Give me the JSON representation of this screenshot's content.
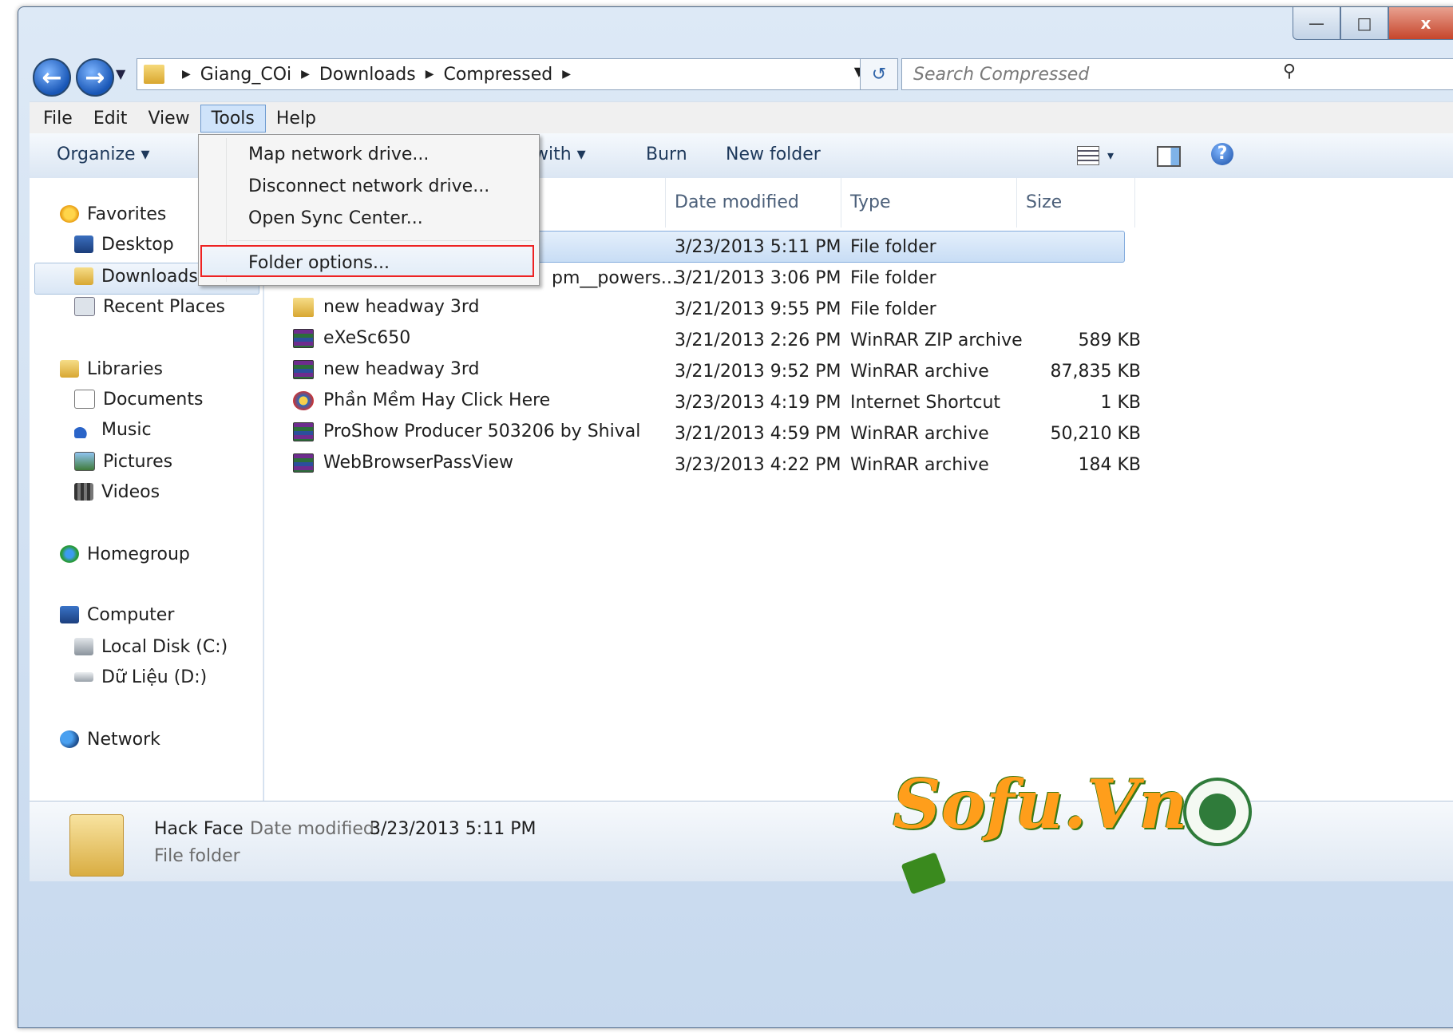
{
  "window": {
    "caption_buttons": {
      "minimize": "—",
      "maximize": "□",
      "close": "x"
    }
  },
  "address": {
    "breadcrumbs": [
      "Giang_COi",
      "Downloads",
      "Compressed"
    ],
    "search_placeholder": "Search Compressed"
  },
  "menubar": {
    "items": [
      "File",
      "Edit",
      "View",
      "Tools",
      "Help"
    ],
    "active": "Tools"
  },
  "toolbar": {
    "organize": "Organize ▾",
    "open_with": "with ▾",
    "burn": "Burn",
    "new_folder": "New folder",
    "view_toggle": "▾"
  },
  "tools_menu": {
    "items": [
      "Map network drive...",
      "Disconnect network drive...",
      "Open Sync Center...",
      "Folder options..."
    ],
    "highlighted": "Folder options..."
  },
  "nav": {
    "favorites": "Favorites",
    "desktop": "Desktop",
    "downloads": "Downloads",
    "recent": "Recent Places",
    "libraries": "Libraries",
    "documents": "Documents",
    "music": "Music",
    "pictures": "Pictures",
    "videos": "Videos",
    "homegroup": "Homegroup",
    "computer": "Computer",
    "local_disk": "Local Disk (C:)",
    "data_disk": "Dữ Liệu (D:)",
    "network": "Network"
  },
  "columns": {
    "date": "Date modified",
    "type": "Type",
    "size": "Size"
  },
  "files": [
    {
      "name": "",
      "date": "3/23/2013 5:11 PM",
      "type": "File folder",
      "size": "",
      "icon": "folder-icon"
    },
    {
      "name": "pm__powers...",
      "date": "3/21/2013 3:06 PM",
      "type": "File folder",
      "size": "",
      "icon": "folder-icon"
    },
    {
      "name": "new headway 3rd",
      "date": "3/21/2013 9:55 PM",
      "type": "File folder",
      "size": "",
      "icon": "folder-icon"
    },
    {
      "name": "eXeSc650",
      "date": "3/21/2013 2:26 PM",
      "type": "WinRAR ZIP archive",
      "size": "589 KB",
      "icon": "winrar-icon"
    },
    {
      "name": "new headway 3rd",
      "date": "3/21/2013 9:52 PM",
      "type": "WinRAR archive",
      "size": "87,835 KB",
      "icon": "winrar-icon"
    },
    {
      "name": "Phần Mềm Hay Click Here",
      "date": "3/23/2013 4:19 PM",
      "type": "Internet Shortcut",
      "size": "1 KB",
      "icon": "internet-shortcut-icon"
    },
    {
      "name": "ProShow Producer 503206 by Shival",
      "date": "3/21/2013 4:59 PM",
      "type": "WinRAR archive",
      "size": "50,210 KB",
      "icon": "winrar-icon"
    },
    {
      "name": "WebBrowserPassView",
      "date": "3/23/2013 4:22 PM",
      "type": "WinRAR archive",
      "size": "184 KB",
      "icon": "winrar-icon"
    }
  ],
  "details": {
    "name": "Hack Face",
    "date_label": "Date modified:",
    "date_value": "3/23/2013 5:11 PM",
    "type": "File folder"
  },
  "watermark": {
    "text": "Sofu.Vn"
  },
  "colors": {
    "selection": "#cde3fb",
    "watermark_orange": "#ff9e1b",
    "watermark_green": "#3a7a16",
    "highlight_border": "#e22222"
  }
}
